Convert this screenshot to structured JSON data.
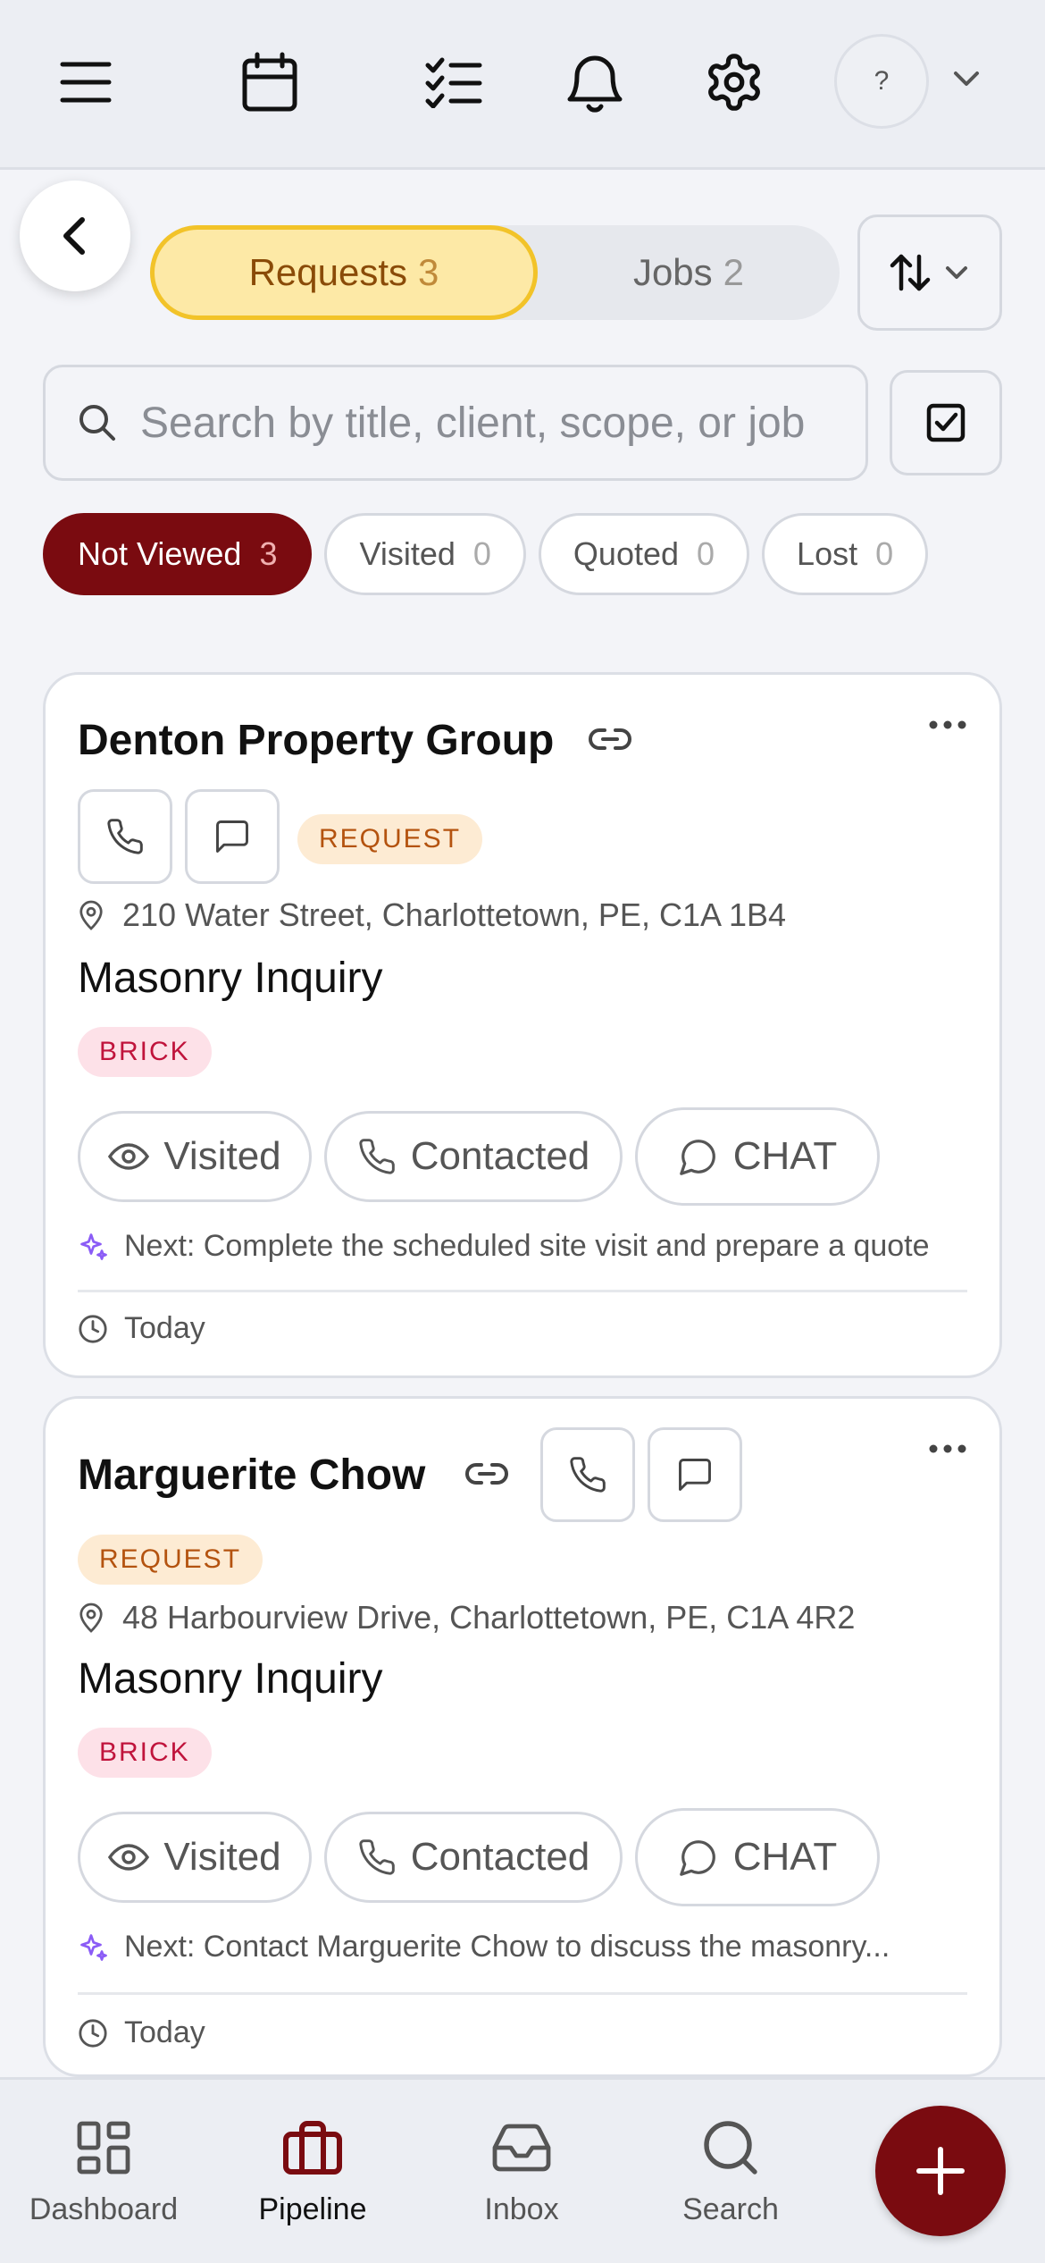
{
  "topbar": {
    "icons": [
      "menu-icon",
      "calendar-icon",
      "checklist-icon",
      "bell-icon",
      "gear-icon"
    ],
    "help_label": "?"
  },
  "tabs": {
    "requests_label": "Requests",
    "requests_count": "3",
    "jobs_label": "Jobs",
    "jobs_count": "2"
  },
  "search": {
    "placeholder": "Search by title, client, scope, or job"
  },
  "filters": [
    {
      "label": "Not Viewed",
      "count": "3",
      "active": true
    },
    {
      "label": "Visited",
      "count": "0",
      "active": false
    },
    {
      "label": "Quoted",
      "count": "0",
      "active": false
    },
    {
      "label": "Lost",
      "count": "0",
      "active": false
    }
  ],
  "requests": [
    {
      "client": "Denton Property Group",
      "badge": "REQUEST",
      "address": "210 Water Street, Charlottetown, PE, C1A 1B4",
      "scope": "Masonry Inquiry",
      "tag": "BRICK",
      "actions": {
        "visited": "Visited",
        "contacted": "Contacted",
        "chat": "CHAT"
      },
      "next": "Next: Complete the scheduled site visit and prepare a quote",
      "date": "Today"
    },
    {
      "client": "Marguerite Chow",
      "badge": "REQUEST",
      "address": "48 Harbourview Drive, Charlottetown, PE, C1A 4R2",
      "scope": "Masonry Inquiry",
      "tag": "BRICK",
      "actions": {
        "visited": "Visited",
        "contacted": "Contacted",
        "chat": "CHAT"
      },
      "next": "Next: Contact Marguerite Chow to discuss the masonry...",
      "date": "Today"
    }
  ],
  "bottom_nav": [
    {
      "label": "Dashboard",
      "icon": "dashboard-icon",
      "active": false
    },
    {
      "label": "Pipeline",
      "icon": "briefcase-icon",
      "active": true
    },
    {
      "label": "Inbox",
      "icon": "inbox-icon",
      "active": false
    },
    {
      "label": "Search",
      "icon": "search-icon",
      "active": false
    }
  ],
  "colors": {
    "brand": "#7a0b10",
    "tab_active_bg": "#fde9a6",
    "tab_active_border": "#f2c329",
    "request_badge_bg": "#fdebd3",
    "brick_badge_bg": "#fde1e8",
    "sparkle": "#8b5cf6"
  }
}
